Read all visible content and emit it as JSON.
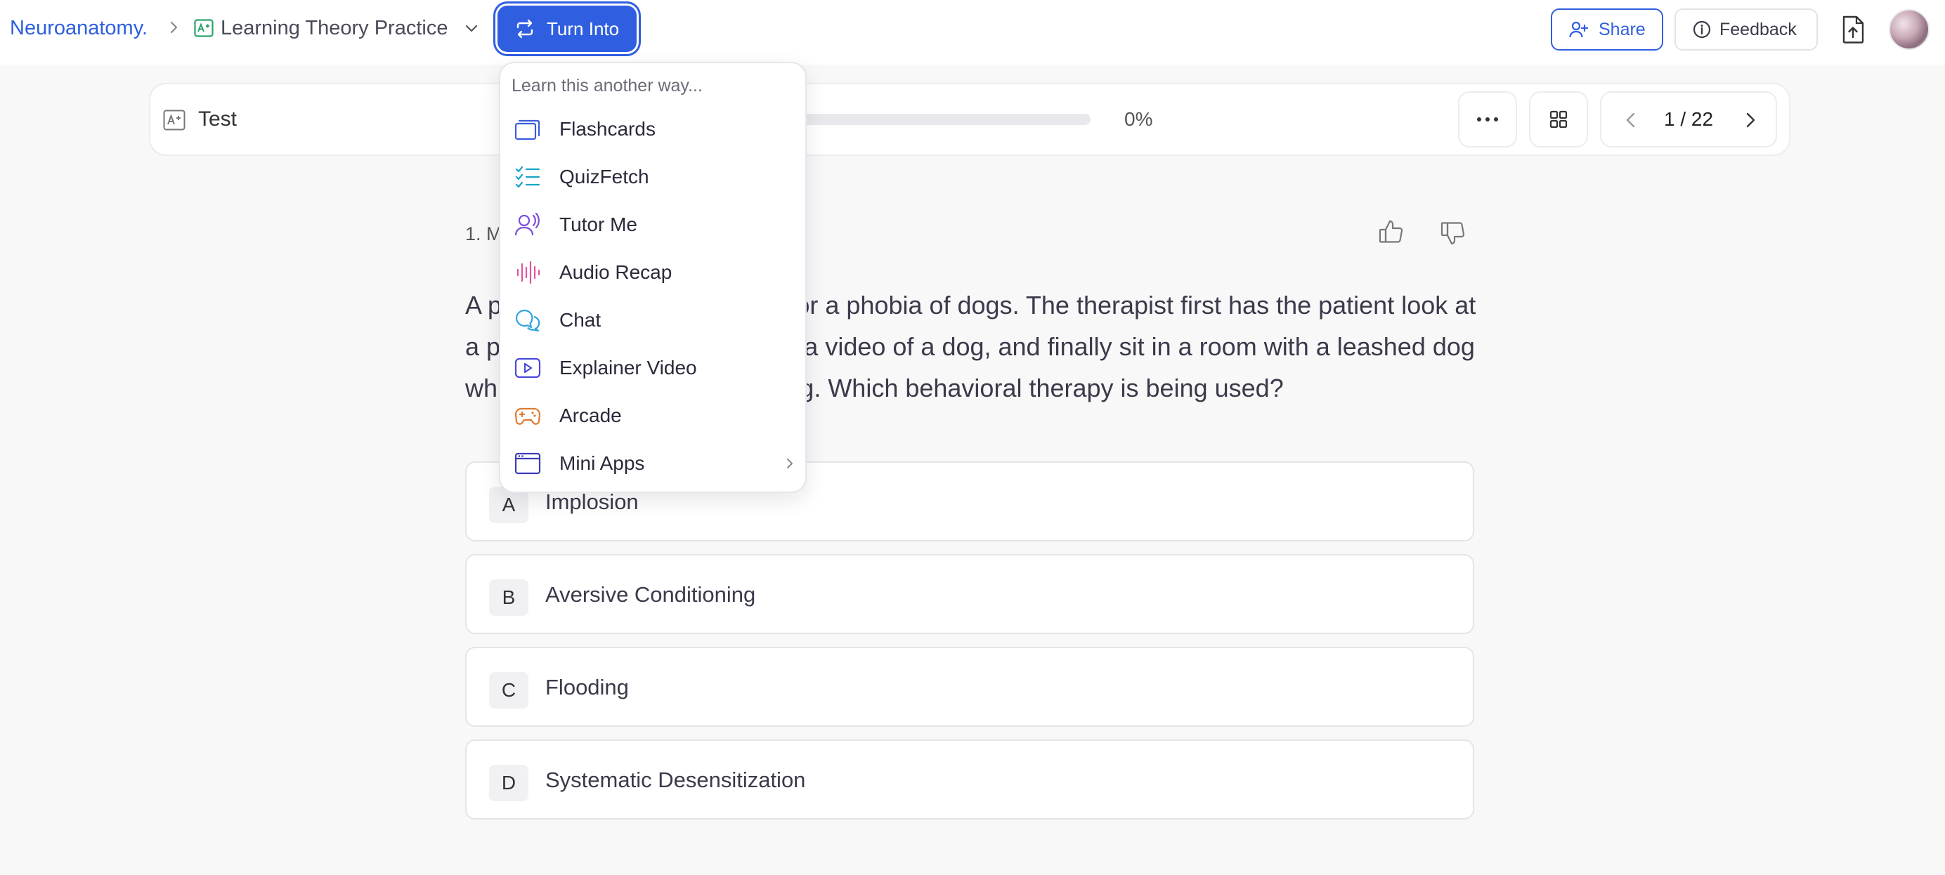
{
  "header": {
    "breadcrumb_root": "Neuroanatomy.",
    "deck_name": "Learning Theory Practice",
    "turn_into_label": "Turn Into",
    "share_label": "Share",
    "feedback_label": "Feedback"
  },
  "test_bar": {
    "label": "Test",
    "progress_percent": 0,
    "progress_text": "0%",
    "pager_text": "1 / 22"
  },
  "question": {
    "number_label": "1. M",
    "text": "A patient undergoes therapy for a phobia of dogs. The therapist first has the patient look at a picture of a dog, then watch a video of a dog, and finally sit in a room with a leashed dog while practicing deep breathing. Which behavioral therapy is being used?",
    "options": [
      {
        "letter": "A",
        "text": "Implosion"
      },
      {
        "letter": "B",
        "text": "Aversive Conditioning"
      },
      {
        "letter": "C",
        "text": "Flooding"
      },
      {
        "letter": "D",
        "text": "Systematic Desensitization"
      }
    ]
  },
  "turn_into_menu": {
    "hint": "Learn this another way...",
    "items": [
      {
        "label": "Flashcards",
        "icon": "flashcards-icon",
        "color": "#3b5bdb"
      },
      {
        "label": "QuizFetch",
        "icon": "checklist-icon",
        "color": "#1aa3c8"
      },
      {
        "label": "Tutor Me",
        "icon": "tutor-voice-icon",
        "color": "#7c4ddb"
      },
      {
        "label": "Audio Recap",
        "icon": "audio-wave-icon",
        "color": "#e0559a"
      },
      {
        "label": "Chat",
        "icon": "chat-bubbles-icon",
        "color": "#2fa4e0"
      },
      {
        "label": "Explainer Video",
        "icon": "video-play-icon",
        "color": "#4a4adb"
      },
      {
        "label": "Arcade",
        "icon": "gamepad-icon",
        "color": "#e07a2f"
      },
      {
        "label": "Mini Apps",
        "icon": "app-window-icon",
        "color": "#3b3bb8"
      }
    ]
  },
  "colors": {
    "accent": "#2f5fe0",
    "background": "#f8f8f9"
  }
}
